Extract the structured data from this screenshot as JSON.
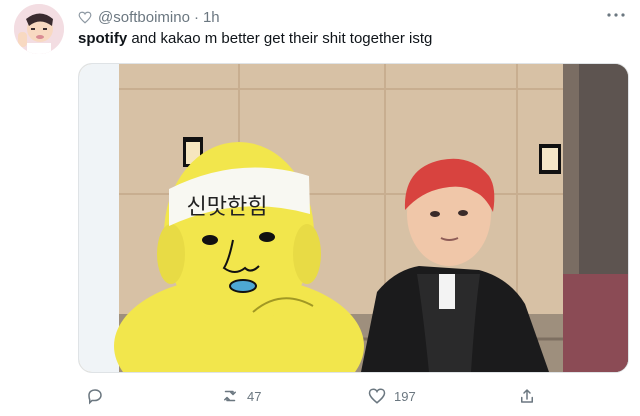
{
  "tweet": {
    "handle": "@softboimino",
    "separator": "·",
    "time": "1h",
    "text_bold": "spotify",
    "text_rest": " and kakao m better get their shit together istg",
    "media_caption": "신맛한힘"
  },
  "actions": {
    "retweets": "47",
    "likes": "197"
  },
  "icons": [
    "heart-outline-icon",
    "more-icon",
    "reply-icon",
    "retweet-icon",
    "like-icon",
    "share-icon"
  ],
  "colors": {
    "muted": "#6b7780",
    "text": "#0f1419",
    "mascot_yellow": "#f2e64c",
    "hair_red": "#d8433f"
  }
}
